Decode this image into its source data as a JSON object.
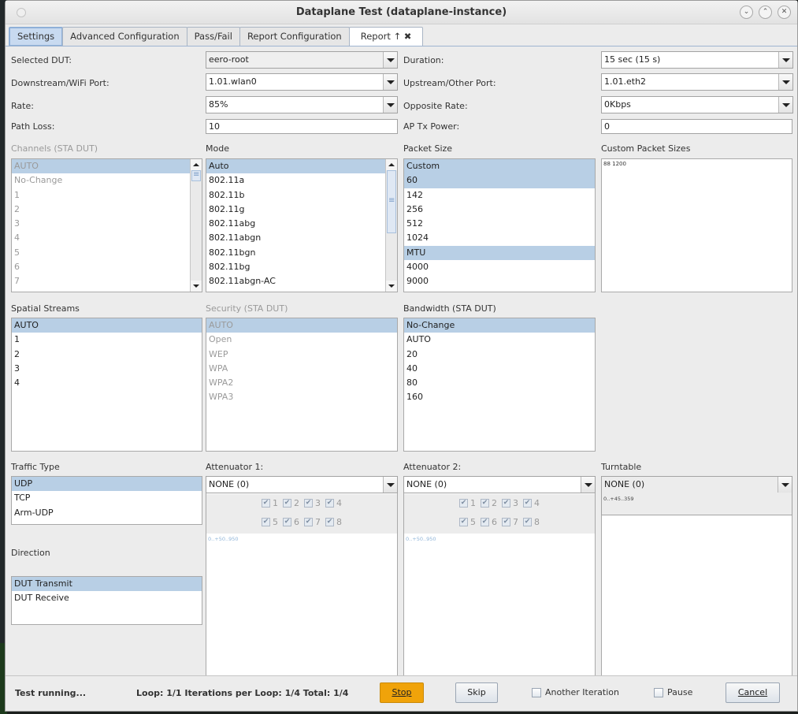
{
  "window": {
    "title": "Dataplane Test (dataplane-instance)",
    "controls": [
      "minimize",
      "maximize",
      "close"
    ]
  },
  "tabs": [
    {
      "label": "Settings",
      "selected": true
    },
    {
      "label": "Advanced Configuration"
    },
    {
      "label": "Pass/Fail"
    },
    {
      "label": "Report Configuration"
    },
    {
      "label": "Report ↑ ✖"
    }
  ],
  "fields": {
    "selected_dut": {
      "label": "Selected DUT:",
      "value": "eero-root"
    },
    "duration": {
      "label": "Duration:",
      "value": "15 sec (15 s)"
    },
    "downstream_port": {
      "label": "Downstream/WiFi Port:",
      "value": "1.01.wlan0"
    },
    "upstream_port": {
      "label": "Upstream/Other Port:",
      "value": "1.01.eth2"
    },
    "rate": {
      "label": "Rate:",
      "value": "85%"
    },
    "opposite_rate": {
      "label": "Opposite Rate:",
      "value": "0Kbps"
    },
    "path_loss": {
      "label": "Path Loss:",
      "value": "10"
    },
    "ap_tx_power": {
      "label": "AP Tx Power:",
      "value": "0"
    }
  },
  "lists": {
    "channels": {
      "label": "Channels (STA DUT)",
      "disabled": true,
      "items": [
        "AUTO",
        "No-Change",
        "1",
        "2",
        "3",
        "4",
        "5",
        "6",
        "7"
      ],
      "selected": [
        0
      ]
    },
    "mode": {
      "label": "Mode",
      "items": [
        "Auto",
        "802.11a",
        "802.11b",
        "802.11g",
        "802.11abg",
        "802.11abgn",
        "802.11bgn",
        "802.11bg",
        "802.11abgn-AC"
      ],
      "selected": [
        0
      ]
    },
    "packet_size": {
      "label": "Packet Size",
      "items": [
        "Custom",
        "60",
        "142",
        "256",
        "512",
        "1024",
        "MTU",
        "4000",
        "9000"
      ],
      "selected": [
        0,
        1,
        6
      ]
    },
    "spatial_streams": {
      "label": "Spatial Streams",
      "items": [
        "AUTO",
        "1",
        "2",
        "3",
        "4"
      ],
      "selected": [
        0
      ]
    },
    "security": {
      "label": "Security (STA DUT)",
      "disabled": true,
      "items": [
        "AUTO",
        "Open",
        "WEP",
        "WPA",
        "WPA2",
        "WPA3"
      ],
      "selected": [
        0
      ]
    },
    "bandwidth": {
      "label": "Bandwidth (STA DUT)",
      "items": [
        "No-Change",
        "AUTO",
        "20",
        "40",
        "80",
        "160"
      ],
      "selected": [
        0
      ]
    },
    "traffic_type": {
      "label": "Traffic Type",
      "items": [
        "UDP",
        "TCP",
        "Arm-UDP"
      ],
      "selected": [
        0
      ]
    },
    "direction": {
      "label": "Direction",
      "items": [
        "DUT Transmit",
        "DUT Receive"
      ],
      "selected": [
        0
      ]
    }
  },
  "custom_packet_sizes": {
    "label": "Custom Packet Sizes",
    "value": "88 1200"
  },
  "attenuator1": {
    "label": "Attenuator 1:",
    "value": "NONE (0)",
    "channels": [
      "1",
      "2",
      "3",
      "4",
      "5",
      "6",
      "7",
      "8"
    ],
    "range": "0..+50..950"
  },
  "attenuator2": {
    "label": "Attenuator 2:",
    "value": "NONE (0)",
    "channels": [
      "1",
      "2",
      "3",
      "4",
      "5",
      "6",
      "7",
      "8"
    ],
    "range": "0..+50..950"
  },
  "turntable": {
    "label": "Turntable",
    "value": "NONE (0)",
    "range": "0..+45..359"
  },
  "status": {
    "state": "Test running...",
    "progress": "Loop: 1/1 Iterations per Loop: 1/4 Total: 1/4",
    "stop_label": "Stop",
    "skip_label": "Skip",
    "another_iteration_label": "Another Iteration",
    "pause_label": "Pause",
    "cancel_label": "Cancel",
    "stop_color": "#f0a30a"
  }
}
